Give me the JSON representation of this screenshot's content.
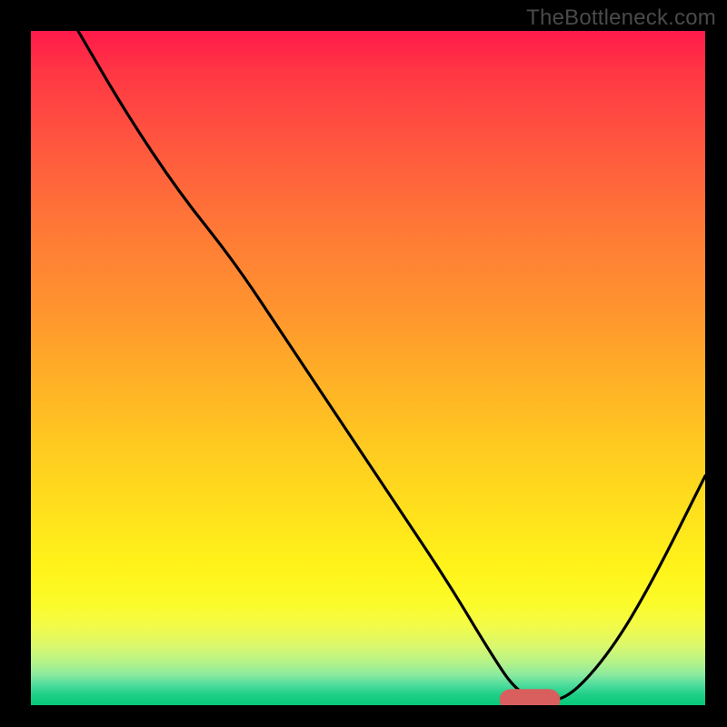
{
  "watermark": "TheBottleneck.com",
  "chart_data": {
    "type": "line",
    "title": "",
    "xlabel": "",
    "ylabel": "",
    "xlim": [
      0,
      100
    ],
    "ylim": [
      0,
      100
    ],
    "grid": false,
    "legend": false,
    "marker": {
      "x": 74,
      "y": 0.8
    },
    "x": [
      7,
      14,
      22,
      30,
      38,
      46,
      54,
      62,
      68,
      72,
      76,
      80,
      86,
      92,
      100
    ],
    "values": [
      100,
      88,
      76,
      66,
      54,
      42,
      30,
      18,
      8,
      2,
      0.5,
      1.2,
      8,
      18,
      34
    ]
  }
}
